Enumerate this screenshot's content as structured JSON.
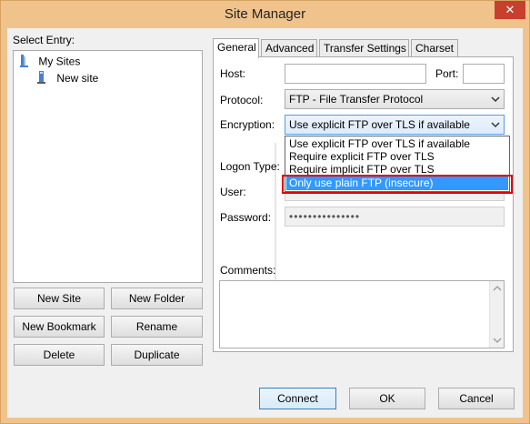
{
  "window": {
    "title": "Site Manager",
    "close_glyph": "✕"
  },
  "left": {
    "select_entry_label": "Select Entry:",
    "tree": {
      "root": "My Sites",
      "child": "New site"
    },
    "buttons": {
      "new_site": "New Site",
      "new_folder": "New Folder",
      "new_bookmark": "New Bookmark",
      "rename": "Rename",
      "delete": "Delete",
      "duplicate": "Duplicate"
    }
  },
  "tabs": [
    "General",
    "Advanced",
    "Transfer Settings",
    "Charset"
  ],
  "general": {
    "host_label": "Host:",
    "host_value": "",
    "port_label": "Port:",
    "port_value": "",
    "protocol_label": "Protocol:",
    "protocol_value": "FTP - File Transfer Protocol",
    "encryption_label": "Encryption:",
    "encryption_value": "Use explicit FTP over TLS if available",
    "logon_label": "Logon Type:",
    "user_label": "User:",
    "password_label": "Password:",
    "password_value": "•••••••••••••••",
    "comments_label": "Comments:",
    "encryption_options": [
      "Use explicit FTP over TLS if available",
      "Require explicit FTP over TLS",
      "Require implicit FTP over TLS",
      "Only use plain FTP (insecure)"
    ]
  },
  "footer": {
    "connect": "Connect",
    "ok": "OK",
    "cancel": "Cancel"
  },
  "colors": {
    "titlebar": "#f0c38c",
    "close": "#c7402d",
    "selection": "#3399ff",
    "highlight": "#e00000"
  }
}
